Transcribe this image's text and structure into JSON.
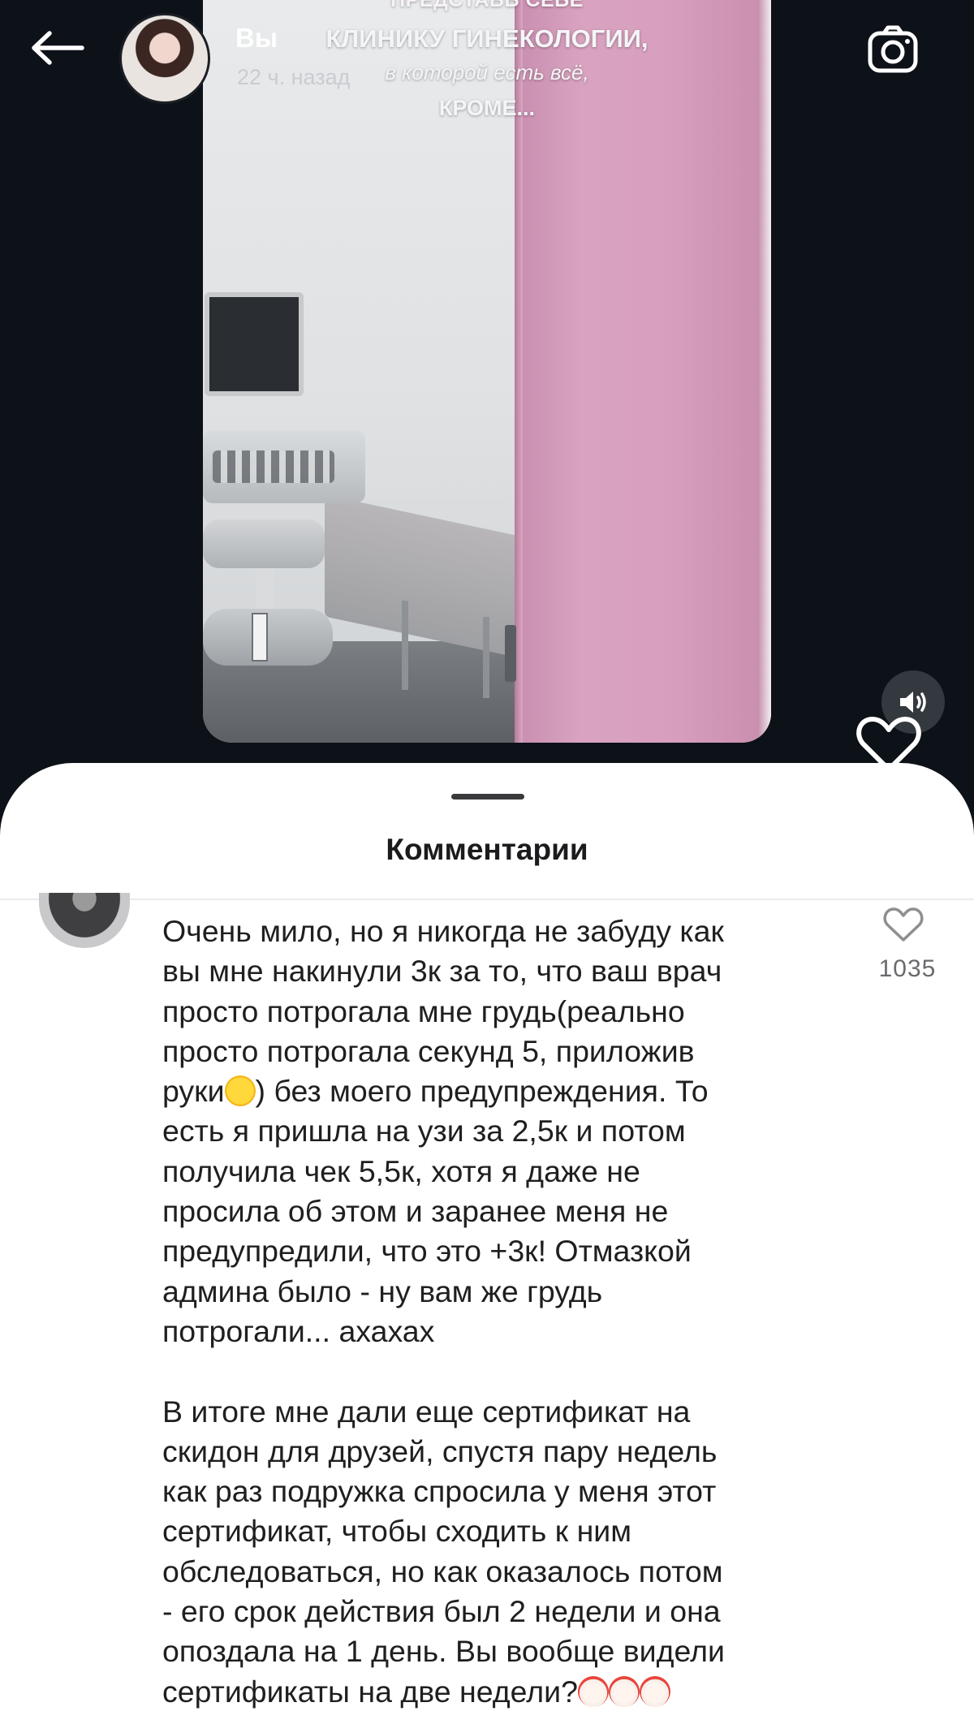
{
  "post": {
    "author_name": "Вы",
    "time_ago": "22 ч. назад",
    "video_overlay": {
      "line1": "ПРЕДСТАВЬ СЕБЕ",
      "line2": "КЛИНИКУ ГИНЕКОЛОГИИ,",
      "line3": "в которой есть всё,",
      "line4": "КРОМЕ..."
    }
  },
  "icons": {
    "back": "arrow-left-icon",
    "camera": "camera-icon",
    "sound": "speaker-icon",
    "like": "heart-icon",
    "comment_like": "heart-outline-icon"
  },
  "comments_sheet": {
    "title": "Комментарии",
    "comments": [
      {
        "text_part1": "Очень мило, но я никогда не забуду как\nвы мне накинули 3к за то, что ваш врач\nпросто потрогала мне грудь(реально\nпросто потрогала секунд 5, приложив\nруки",
        "emoji1": "😂",
        "text_part2": ") без моего предупреждения. То\nесть я пришла на узи за 2,5к и потом\nполучила чек 5,5к, хотя я даже не\nпросила об этом и заранее меня не\nпредупредили, что это +3к! Отмазкой\nадмина было - ну вам же грудь\nпотрогали... ахахах\n\nВ итоге мне дали еще сертификат на\nскидон для друзей, спустя пару недель\nкак раз подружка спросила у меня этот\nсертификат, чтобы сходить к ним\nобследоваться, но как оказалось потом\n- его срок действия был 2 недели и она\nопоздала на 1 день. Вы вообще видели\nсертификаты на две недели?",
        "emoji_tail": "🤡🤡🤡",
        "like_count": "1035"
      }
    ]
  },
  "colors": {
    "background": "#0d1118",
    "sheet": "#ffffff",
    "text": "#1f1f21",
    "muted": "#6a6a6e",
    "accent_pink": "#d79fbd"
  }
}
